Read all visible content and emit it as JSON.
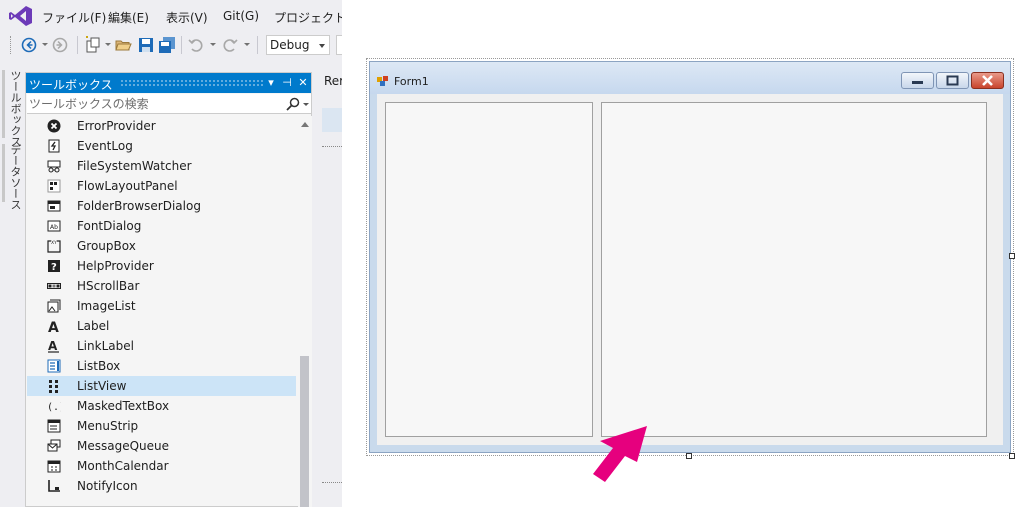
{
  "ide": {
    "menu": [
      "ファイル(F)",
      "編集(E)",
      "表示(V)",
      "Git(G)",
      "プロジェクト(P)"
    ],
    "toolbar": {
      "config": "Debug",
      "icons": [
        "back-icon",
        "forward-icon",
        "new-project-icon",
        "open-folder-icon",
        "save-icon",
        "save-all-icon",
        "undo-icon",
        "redo-icon"
      ]
    },
    "side_tabs": [
      "ツールボックス",
      "データソース"
    ],
    "toolbox": {
      "title": "ツールボックス",
      "search_placeholder": "ツールボックスの検索",
      "items": [
        {
          "label": "ErrorProvider",
          "icon": "error-provider-icon"
        },
        {
          "label": "EventLog",
          "icon": "eventlog-icon"
        },
        {
          "label": "FileSystemWatcher",
          "icon": "filesystemwatcher-icon"
        },
        {
          "label": "FlowLayoutPanel",
          "icon": "flowlayoutpanel-icon"
        },
        {
          "label": "FolderBrowserDialog",
          "icon": "folderbrowserdialog-icon"
        },
        {
          "label": "FontDialog",
          "icon": "fontdialog-icon"
        },
        {
          "label": "GroupBox",
          "icon": "groupbox-icon"
        },
        {
          "label": "HelpProvider",
          "icon": "helpprovider-icon"
        },
        {
          "label": "HScrollBar",
          "icon": "hscrollbar-icon"
        },
        {
          "label": "ImageList",
          "icon": "imagelist-icon"
        },
        {
          "label": "Label",
          "icon": "label-icon"
        },
        {
          "label": "LinkLabel",
          "icon": "linklabel-icon"
        },
        {
          "label": "ListBox",
          "icon": "listbox-icon"
        },
        {
          "label": "ListView",
          "icon": "listview-icon",
          "selected": true
        },
        {
          "label": "MaskedTextBox",
          "icon": "maskedtextbox-icon"
        },
        {
          "label": "MenuStrip",
          "icon": "menustrip-icon"
        },
        {
          "label": "MessageQueue",
          "icon": "messagequeue-icon"
        },
        {
          "label": "MonthCalendar",
          "icon": "monthcalendar-icon"
        },
        {
          "label": "NotifyIcon",
          "icon": "notifyicon-icon"
        }
      ]
    },
    "editor_tab_label": "Rer"
  },
  "designer": {
    "form_title": "Form1",
    "annotation": "pink arrow pointing at the right panel"
  },
  "colors": {
    "accent": "#007acc",
    "selection": "#cce4f7",
    "arrow": "#e6007e",
    "form_border": "#c9daec"
  }
}
